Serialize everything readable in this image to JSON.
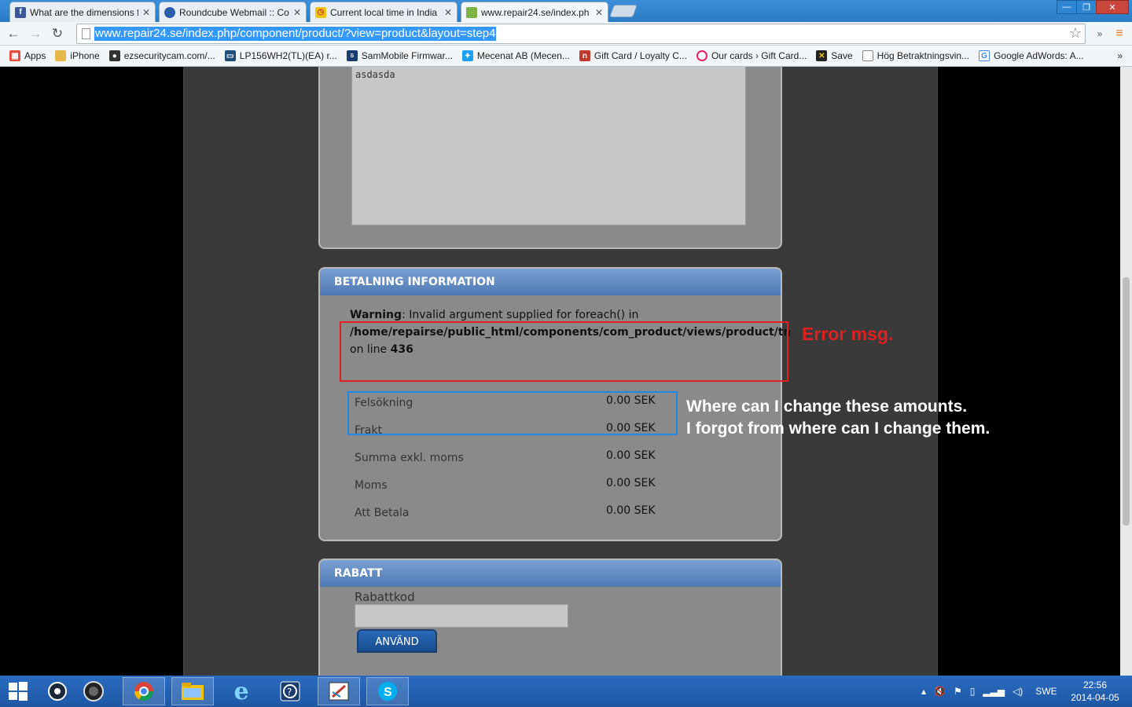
{
  "browser": {
    "tabs": [
      {
        "title": "What are the dimensions f",
        "favicon": "facebook-icon",
        "color": "#3b5998"
      },
      {
        "title": "Roundcube Webmail :: Co",
        "favicon": "roundcube-icon",
        "color": "#2a5ea8"
      },
      {
        "title": "Current local time in India",
        "favicon": "clock-icon",
        "color": "#c0392b"
      },
      {
        "title": "www.repair24.se/index.ph",
        "favicon": "page-icon",
        "color": "#2e7d32"
      }
    ],
    "url": "www.repair24.se/index.php/component/product/?view=product&layout=step4",
    "window_buttons": [
      "—",
      "❐",
      "✕"
    ],
    "bookmarks": [
      {
        "label": "Apps",
        "icon": "apps-grid-icon",
        "color": "#e74c3c"
      },
      {
        "label": "iPhone",
        "icon": "folder-icon",
        "color": "#e6b94a"
      },
      {
        "label": "ezsecuritycam.com/...",
        "icon": "camera-icon",
        "color": "#333333"
      },
      {
        "label": "LP156WH2(TL)(EA) r...",
        "icon": "monitor-icon",
        "color": "#1f4e79"
      },
      {
        "label": "SamMobile Firmwar...",
        "icon": "sammobile-icon",
        "color": "#1a3c6e"
      },
      {
        "label": "Mecenat AB (Mecen...",
        "icon": "twitter-icon",
        "color": "#1da1f2"
      },
      {
        "label": "Gift Card / Loyalty C...",
        "icon": "n-logo-icon",
        "color": "#c0392b"
      },
      {
        "label": "Our cards › Gift Card...",
        "icon": "ring-icon",
        "color": "#e91e63"
      },
      {
        "label": "Save",
        "icon": "save-icon",
        "color": "#222222"
      },
      {
        "label": "Hög Betraktningsvin...",
        "icon": "page-icon",
        "color": "#888888"
      },
      {
        "label": "Google AdWords: A...",
        "icon": "google-icon",
        "color": "#4285f4"
      }
    ]
  },
  "page": {
    "comment_text": "asdasda",
    "payment": {
      "title": "BETALNING INFORMATION",
      "warning_label": "Warning",
      "warning_text": ": Invalid argument supplied for foreach() in",
      "warning_path": "/home/repairse/public_html/components/com_product/views/product/tm",
      "warning_line_prefix": "on line ",
      "warning_line_number": "436",
      "rows": [
        {
          "label": "Felsökning",
          "amount": "0.00 SEK"
        },
        {
          "label": "Frakt",
          "amount": "0.00 SEK"
        },
        {
          "label": "Summa exkl. moms",
          "amount": "0.00 SEK"
        },
        {
          "label": "Moms",
          "amount": "0.00 SEK"
        },
        {
          "label": "Att Betala",
          "amount": "0.00 SEK"
        }
      ]
    },
    "discount": {
      "title": "RABATT",
      "code_label": "Rabattkod",
      "code_value": "",
      "apply_label": "ANVÄND"
    }
  },
  "annotations": {
    "error_label": "Error msg.",
    "error_color": "#e02020",
    "question_line1": "Where can I change these amounts.",
    "question_line2": "I forgot from where can I change them.",
    "question_box_color": "#1e88e5"
  },
  "taskbar": {
    "apps": [
      "windows-start-icon",
      "steam-icon",
      "camera-app-icon",
      "chrome-icon",
      "file-explorer-icon",
      "internet-explorer-icon",
      "help-icon",
      "paint-icon",
      "skype-icon"
    ],
    "language": "SWE",
    "time": "22:56",
    "date": "2014-04-05"
  }
}
